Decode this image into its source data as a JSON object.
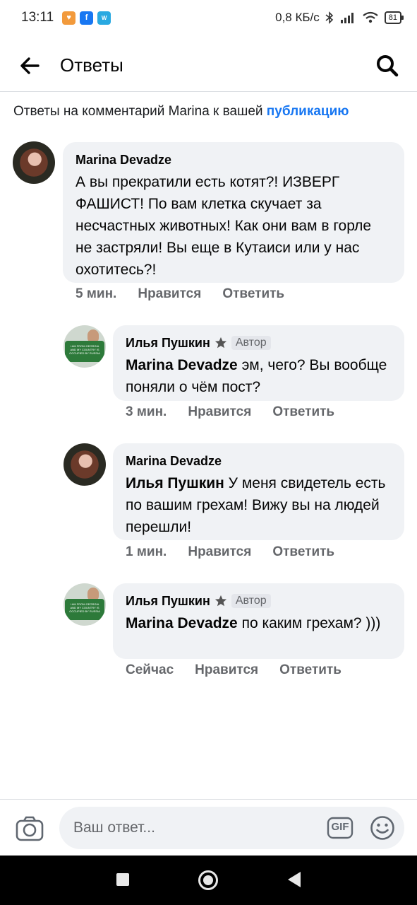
{
  "status_bar": {
    "time": "13:11",
    "apps": [
      {
        "icon": "heart-app-icon",
        "color": "#f29a3c",
        "glyph": "♥"
      },
      {
        "icon": "facebook-app-icon",
        "color": "#1877f2",
        "glyph": "f"
      },
      {
        "icon": "wolt-app-icon",
        "color": "#29a9e1",
        "glyph": "W"
      }
    ],
    "network_speed": "0,8 КБ/с",
    "battery": "81"
  },
  "header": {
    "title": "Ответы"
  },
  "context": {
    "prefix": "Ответы на комментарий Marina к вашей ",
    "link": "публикацию"
  },
  "comments": [
    {
      "author": "Marina Devadze",
      "is_author": false,
      "badge": "",
      "mention": "",
      "text": "А вы прекратили есть котят?! ИЗВЕРГ ФАШИСТ! По вам клетка скучает  за несчастных животных! Как они вам в горле не застряли! Вы еще в Кутаиси или у нас  охотитесь?!",
      "time": "5 мин.",
      "like": "Нравится",
      "reply": "Ответить"
    },
    {
      "author": "Илья Пушкин",
      "is_author": true,
      "badge": "Автор",
      "mention": "Marina Devadze",
      "text": " эм, чего? Вы вообще поняли о чём пост?",
      "time": "3 мин.",
      "like": "Нравится",
      "reply": "Ответить"
    },
    {
      "author": "Marina Devadze",
      "is_author": false,
      "badge": "",
      "mention": "Илья Пушкин",
      "text": " У меня свидетель есть по вашим грехам! Вижу вы на людей перешли!",
      "time": "1 мин.",
      "like": "Нравится",
      "reply": "Ответить"
    },
    {
      "author": "Илья Пушкин",
      "is_author": true,
      "badge": "Автор",
      "mention": "Marina Devadze",
      "text": " по каким грехам? )))",
      "time": "Сейчас",
      "like": "Нравится",
      "reply": "Ответить"
    }
  ],
  "composer": {
    "placeholder": "Ваш ответ...",
    "gif_label": "GIF"
  },
  "colors": {
    "link": "#1877f2",
    "bubble": "#f0f2f5",
    "meta_text": "#65676b"
  }
}
